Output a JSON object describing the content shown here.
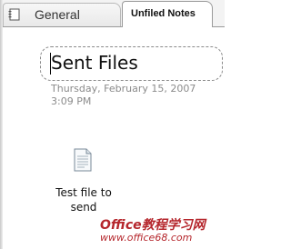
{
  "tabs": [
    {
      "label": "General",
      "active": false
    },
    {
      "label": "Unfiled Notes",
      "active": true
    }
  ],
  "page": {
    "title": "Sent Files",
    "date": "Thursday, February 15, 2007",
    "time": "3:09 PM"
  },
  "attachment": {
    "icon": "text-file-icon",
    "label": "Test file to send"
  },
  "watermark": {
    "brand": "Office教程学习网",
    "url": "www.office68.com"
  }
}
